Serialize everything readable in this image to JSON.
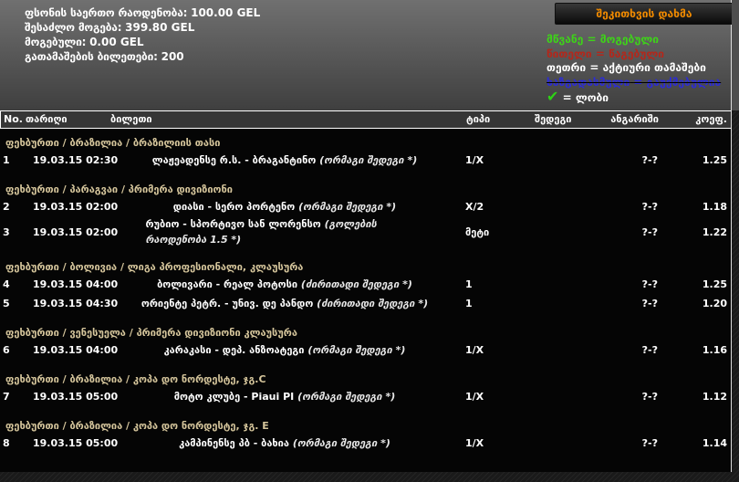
{
  "stats": [
    {
      "label": "ფსონის საერთო რაოდენობა:",
      "value": "100.00 GEL"
    },
    {
      "label": "შესაძლო მოგება:",
      "value": "399.80 GEL"
    },
    {
      "label": "მოგებული:",
      "value": "0.00 GEL"
    },
    {
      "label": "გათამაშების ბილეთები:",
      "value": "200"
    }
  ],
  "help_button": {
    "label": "შეკითხვის დახმა",
    "text_color": "#f08a00"
  },
  "legend": [
    {
      "term": "მწვანე",
      "desc": "= მოგებული",
      "term_color": "#3ed219",
      "desc_color": "#3ed219",
      "strike": false,
      "check": false
    },
    {
      "term": "წითელი",
      "desc": "= წაგებული",
      "term_color": "#b3271b",
      "desc_color": "#b3271b",
      "strike": false,
      "check": false
    },
    {
      "term": "თეთრი",
      "desc": "= აქტიური თამაშები",
      "term_color": "#ffffff",
      "desc_color": "#ffffff",
      "strike": false,
      "check": false
    },
    {
      "term": "ხაზგადასმული",
      "desc": "= გაუქმებულია",
      "term_color": "#2b2bd8",
      "desc_color": "#2b2bd8",
      "strike": true,
      "check": false
    },
    {
      "term": "✔",
      "desc": "= ლობი",
      "term_color": "#2ed216",
      "desc_color": "#ffffff",
      "strike": false,
      "check": true
    }
  ],
  "table": {
    "headers": [
      "No.",
      "თარიღი",
      "ბილეთი",
      "ტიპი",
      "შედეგი",
      "ანგარიში",
      "კოეფ."
    ],
    "category_color": "#d6c69c",
    "groups": [
      {
        "category": "ფეხბურთი / ბრაზილია / ბრაზილიის თასი",
        "rows": [
          {
            "no": "1",
            "date": "19.03.15 02:30",
            "match": "ლაჟეადენსე რ.ს. - ბრაგანტინო",
            "bet": "(ორმაგი შედეგი *)",
            "type": "1/X",
            "result": "",
            "account": "?-?",
            "coef": "1.25",
            "wrap": false
          }
        ]
      },
      {
        "category": "ფეხბურთი / პარაგვაი / პრიმერა დივიზიონი",
        "rows": [
          {
            "no": "2",
            "date": "19.03.15 02:00",
            "match": "დიასი - სერო პორტენო",
            "bet": "(ორმაგი შედეგი *)",
            "type": "X/2",
            "result": "",
            "account": "?-?",
            "coef": "1.18",
            "wrap": false
          },
          {
            "no": "3",
            "date": "19.03.15 02:00",
            "match": "რუბიო - სპორტივო სან ლორენსო",
            "bet": "(გოლების რაოდენობა 1.5 *)",
            "type": "მეტი",
            "result": "",
            "account": "?-?",
            "coef": "1.22",
            "wrap": true
          }
        ]
      },
      {
        "category": "ფეხბურთი / ბოლივია / ლიგა პროფესიონალი, კლაუსურა",
        "rows": [
          {
            "no": "4",
            "date": "19.03.15 04:00",
            "match": "ბოლივარი - რეალ პოტოსი",
            "bet": "(ძირითადი შედეგი *)",
            "type": "1",
            "result": "",
            "account": "?-?",
            "coef": "1.25",
            "wrap": false
          },
          {
            "no": "5",
            "date": "19.03.15 04:30",
            "match": "ორიენტე პეტრ. - უნივ. დე პანდო",
            "bet": "(ძირითადი შედეგი *)",
            "type": "1",
            "result": "",
            "account": "?-?",
            "coef": "1.20",
            "wrap": false
          }
        ]
      },
      {
        "category": "ფეხბურთი / ვენესუელა / პრიმერა დივიზიონი კლაუსურა",
        "rows": [
          {
            "no": "6",
            "date": "19.03.15 04:00",
            "match": "კარაკასი - დეპ. ანზოატეგი",
            "bet": "(ორმაგი შედეგი *)",
            "type": "1/X",
            "result": "",
            "account": "?-?",
            "coef": "1.16",
            "wrap": false
          }
        ]
      },
      {
        "category": "ფეხბურთი / ბრაზილია / კოპა დო ნორდესტე, ჯგ.C",
        "rows": [
          {
            "no": "7",
            "date": "19.03.15 05:00",
            "match": "მოტო კლუბე - Piaui PI",
            "bet": "(ორმაგი შედეგი *)",
            "type": "1/X",
            "result": "",
            "account": "?-?",
            "coef": "1.12",
            "wrap": false
          }
        ]
      },
      {
        "category": "ფეხბურთი / ბრაზილია / კოპა დო ნორდესტე, ჯგ. E",
        "rows": [
          {
            "no": "8",
            "date": "19.03.15 05:00",
            "match": "კამპინენსე პბ - ბახია",
            "bet": "(ორმაგი შედეგი *)",
            "type": "1/X",
            "result": "",
            "account": "?-?",
            "coef": "1.14",
            "wrap": false
          }
        ]
      }
    ]
  }
}
